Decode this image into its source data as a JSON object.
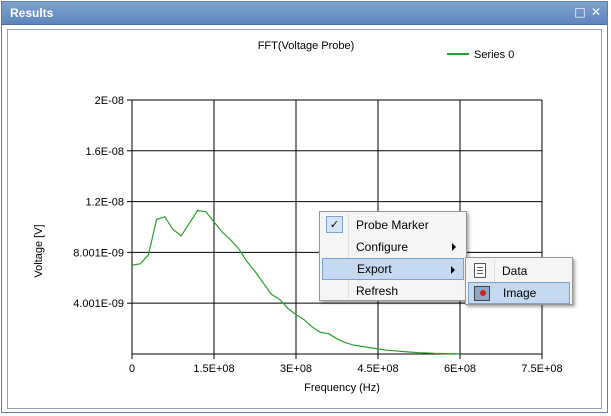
{
  "window": {
    "title": "Results",
    "maximize_icon": "maximize-icon",
    "close_icon": "close-icon"
  },
  "chart_data": {
    "type": "line",
    "title": "FFT(Voltage Probe)",
    "xlabel": "Frequency (Hz)",
    "ylabel": "Voltage [V]",
    "xlim": [
      0,
      750000000
    ],
    "ylim": [
      0,
      2e-08
    ],
    "x_ticks": [
      "0",
      "1.5E+08",
      "3E+08",
      "4.5E+08",
      "6E+08",
      "7.5E+08"
    ],
    "y_ticks": [
      "4.001E-09",
      "8.001E-09",
      "1.2E-08",
      "1.6E-08",
      "2E-08"
    ],
    "grid": true,
    "legend_position": "top-right",
    "series": [
      {
        "name": "Series 0",
        "color": "#2ca02c",
        "x": [
          0,
          15000000,
          30000000,
          45000000,
          60000000,
          75000000,
          90000000,
          105000000,
          120000000,
          135000000,
          150000000,
          165000000,
          180000000,
          195000000,
          210000000,
          225000000,
          240000000,
          255000000,
          270000000,
          285000000,
          300000000,
          315000000,
          330000000,
          345000000,
          360000000,
          375000000,
          390000000,
          405000000,
          420000000,
          435000000,
          450000000,
          465000000,
          480000000,
          495000000,
          510000000,
          525000000,
          540000000,
          555000000,
          570000000,
          585000000,
          600000000
        ],
        "values": [
          7e-09,
          7.1e-09,
          7.8e-09,
          1.06e-08,
          1.08e-08,
          9.8e-09,
          9.3e-09,
          1.03e-08,
          1.13e-08,
          1.12e-08,
          1.04e-08,
          9.6e-09,
          9e-09,
          8.3e-09,
          7.3e-09,
          6.5e-09,
          5.6e-09,
          4.7e-09,
          4.3e-09,
          3.6e-09,
          3.1e-09,
          2.7e-09,
          2.1e-09,
          1.7e-09,
          1.6e-09,
          1.2e-09,
          9e-10,
          7e-10,
          6e-10,
          5e-10,
          4e-10,
          3e-10,
          2.5e-10,
          2e-10,
          1.5e-10,
          1e-10,
          8e-11,
          5e-11,
          3e-11,
          2e-11,
          1e-11
        ]
      }
    ]
  },
  "context_menu": {
    "items": [
      {
        "label": "Probe Marker",
        "checked": true
      },
      {
        "label": "Configure",
        "submenu": true
      },
      {
        "label": "Export",
        "submenu": true,
        "highlighted": true
      },
      {
        "label": "Refresh"
      }
    ]
  },
  "submenu": {
    "items": [
      {
        "label": "Data",
        "icon": "data-icon"
      },
      {
        "label": "Image",
        "icon": "image-icon",
        "highlighted": true
      }
    ]
  }
}
